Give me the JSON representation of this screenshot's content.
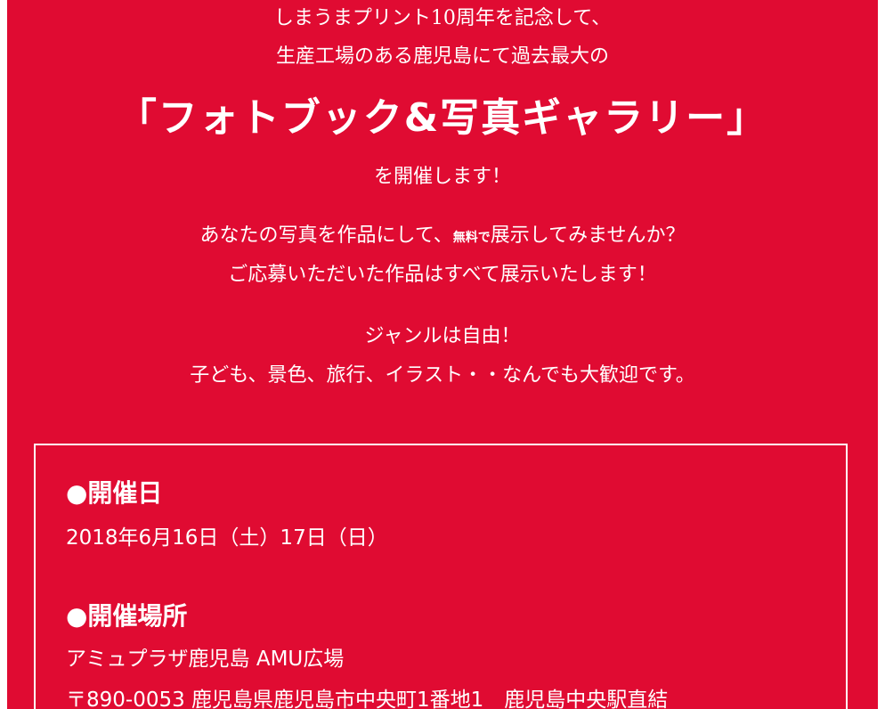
{
  "intro": {
    "line1": "しまうまプリント10周年を記念して、",
    "line2": "生産工場のある鹿児島にて過去最大の",
    "headline": "「フォトブック&写真ギャラリー」",
    "line3": "を開催します！",
    "line4_pre": "あなたの写真を作品にして、",
    "line4_small": "無料で",
    "line4_post": "展示してみませんか？",
    "line5": "ご応募いただいた作品はすべて展示いたします！",
    "line6": "ジャンルは自由！",
    "line7": "子ども、景色、旅行、イラスト・・なんでも大歓迎です。"
  },
  "info": {
    "date_heading": "●開催日",
    "date_value": "2018年6月16日（土）17日（日）",
    "venue_heading": "●開催場所",
    "venue_name": "アミュプラザ鹿児島 AMU広場",
    "venue_address": "〒890-0053 鹿児島県鹿児島市中央町1番地1　鹿児島中央駅直結"
  },
  "colors": {
    "background": "#e00b32",
    "text": "#ffffff"
  }
}
